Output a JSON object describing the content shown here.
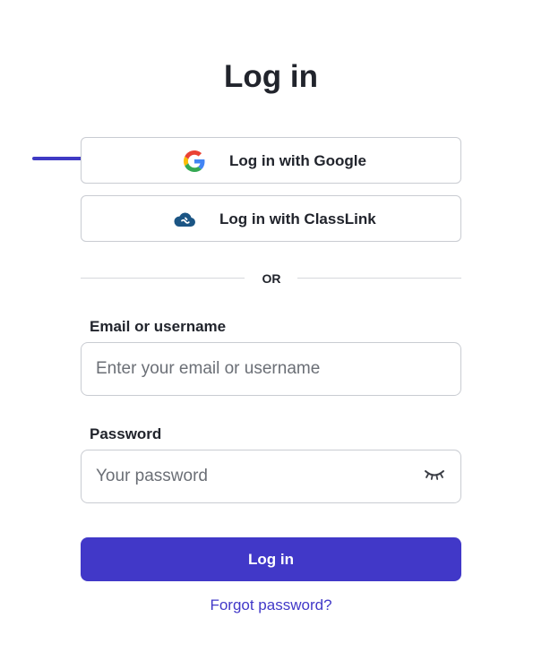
{
  "page": {
    "title": "Log in"
  },
  "sso": {
    "google": {
      "label": "Log in with Google",
      "icon": "google-icon"
    },
    "classlink": {
      "label": "Log in with ClassLink",
      "icon": "classlink-icon"
    }
  },
  "divider": {
    "text": "OR"
  },
  "email": {
    "label": "Email or username",
    "placeholder": "Enter your email or username",
    "value": ""
  },
  "password": {
    "label": "Password",
    "placeholder": "Your password",
    "value": "",
    "toggle_icon": "eye-closed-icon"
  },
  "submit": {
    "label": "Log in"
  },
  "forgot": {
    "label": "Forgot password?"
  },
  "colors": {
    "primary": "#4138c8",
    "annotation_arrow": "#3f3ac4",
    "border": "#c9ccd2",
    "text": "#21242c"
  }
}
